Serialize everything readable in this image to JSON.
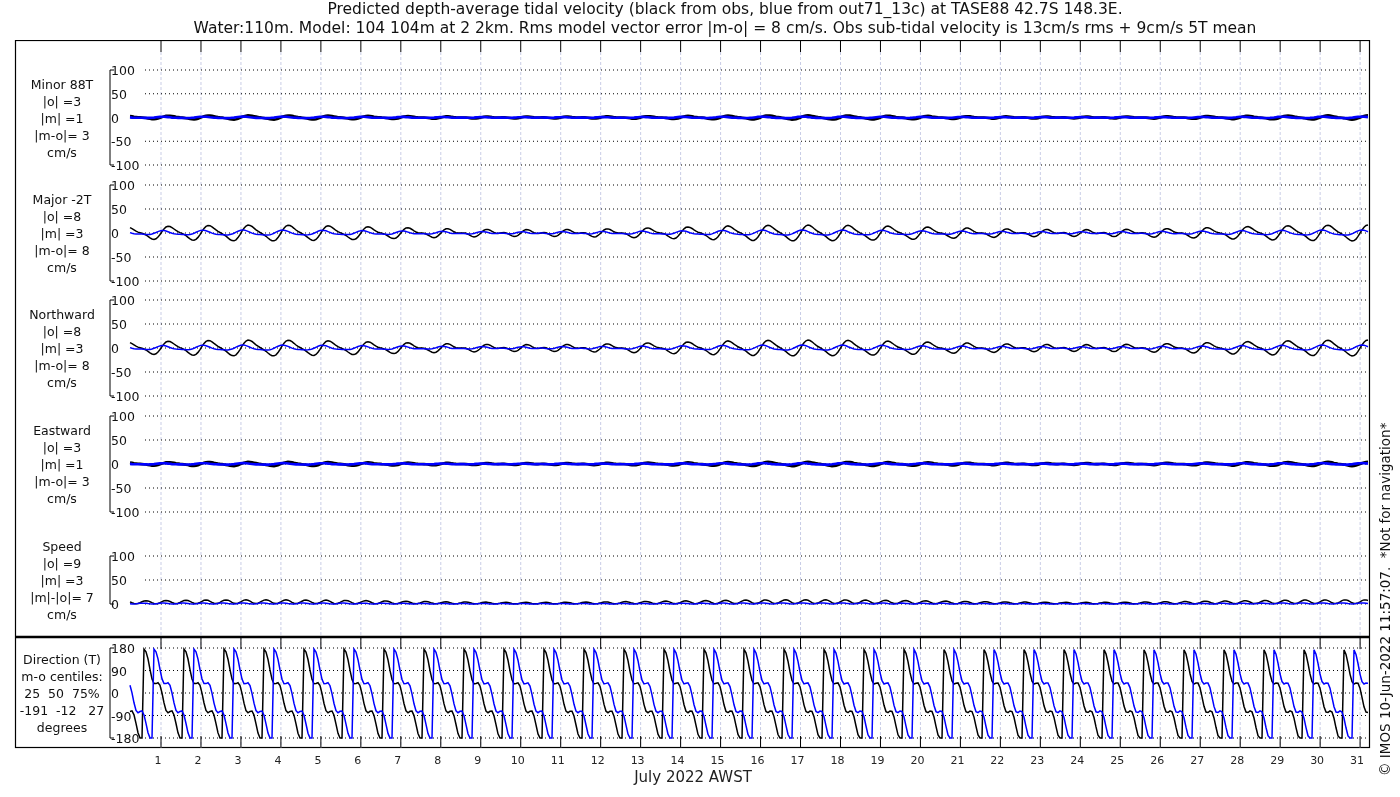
{
  "title": [
    "Predicted depth-average tidal velocity (black from obs, blue from out71_13c) at TASE88 42.7S 148.3E.",
    "Water:110m. Model: 104 104m at 2 2km. Rms model vector error |m-o| = 8 cm/s. Obs sub-tidal velocity is 13cm/s rms + 9cm/s 5T mean"
  ],
  "panels": [
    {
      "kind": "velocity",
      "label": [
        "Minor 88T",
        "|o| =3",
        "|m| =1",
        "|m-o|= 3",
        "cm/s"
      ],
      "yticks": [
        "100",
        "50",
        "0",
        "-50",
        "-100"
      ]
    },
    {
      "kind": "velocity",
      "label": [
        "Major -2T",
        "|o| =8",
        "|m| =3",
        "|m-o|= 8",
        "cm/s"
      ],
      "yticks": [
        "100",
        "50",
        "0",
        "-50",
        "-100"
      ]
    },
    {
      "kind": "velocity",
      "label": [
        "Northward",
        "|o| =8",
        "|m| =3",
        "|m-o|= 8",
        "cm/s"
      ],
      "yticks": [
        "100",
        "50",
        "0",
        "-50",
        "-100"
      ]
    },
    {
      "kind": "velocity",
      "label": [
        "Eastward",
        "|o| =3",
        "|m| =1",
        "|m-o|= 3",
        "cm/s"
      ],
      "yticks": [
        "100",
        "50",
        "0",
        "-50",
        "-100"
      ]
    },
    {
      "kind": "speed",
      "label": [
        "Speed",
        "|o| =9",
        "|m| =3",
        "|m|-|o|= 7",
        "cm/s"
      ],
      "yticks": [
        "100",
        "50",
        "0"
      ]
    },
    {
      "kind": "direction",
      "label": [
        "Direction (T)",
        "m-o centiles:",
        "25  50  75%",
        "-191  -12   27",
        "degrees"
      ],
      "yticks": [
        "180",
        "90",
        "0",
        "-90",
        "-180"
      ]
    }
  ],
  "xticks": [
    "1",
    "2",
    "3",
    "4",
    "5",
    "6",
    "7",
    "8",
    "9",
    "10",
    "11",
    "12",
    "13",
    "14",
    "15",
    "16",
    "17",
    "18",
    "19",
    "20",
    "21",
    "22",
    "23",
    "24",
    "25",
    "26",
    "27",
    "28",
    "29",
    "30",
    "31"
  ],
  "xlabel": "July 2022 AWST",
  "copyright": "© IMOS 10-Jun-2022 11:57:07.  *Not for navigation*"
}
